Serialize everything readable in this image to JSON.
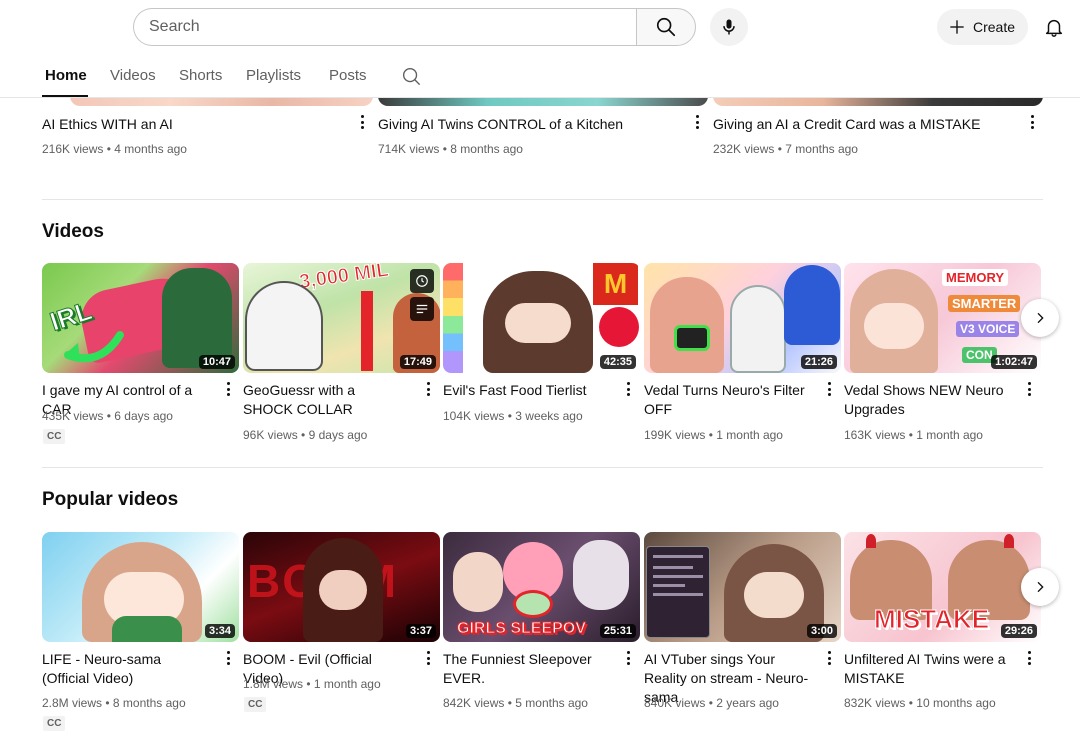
{
  "header": {
    "search_placeholder": "Search",
    "create_label": "Create"
  },
  "tabs": [
    "Home",
    "Videos",
    "Shorts",
    "Playlists",
    "Posts"
  ],
  "top_row": [
    {
      "title": "AI Ethics WITH an AI",
      "views": "216K views",
      "age": "4 months ago"
    },
    {
      "title": "Giving AI Twins CONTROL of a Kitchen",
      "views": "714K views",
      "age": "8 months ago"
    },
    {
      "title": "Giving an AI a Credit Card was a MISTAKE",
      "views": "232K views",
      "age": "7 months ago"
    }
  ],
  "videos_section": {
    "title": "Videos",
    "items": [
      {
        "title": "I gave my AI control of a CAR",
        "views": "435K views",
        "age": "6 days ago",
        "duration": "10:47",
        "cc": "CC"
      },
      {
        "title": "GeoGuessr with a SHOCK COLLAR",
        "views": "96K views",
        "age": "9 days ago",
        "duration": "17:49"
      },
      {
        "title": "Evil's Fast Food Tierlist",
        "views": "104K views",
        "age": "3 weeks ago",
        "duration": "42:35"
      },
      {
        "title": "Vedal Turns Neuro's Filter OFF",
        "views": "199K views",
        "age": "1 month ago",
        "duration": "21:26"
      },
      {
        "title": "Vedal Shows NEW Neuro Upgrades",
        "views": "163K views",
        "age": "1 month ago",
        "duration": "1:02:47"
      }
    ],
    "thumb_text": {
      "irl": "IRL",
      "miles": "3,000 MIL",
      "memory": "MEMORY",
      "smarter": "SMARTER",
      "v3": "V3 VOICE",
      "con": "CON"
    }
  },
  "popular_section": {
    "title": "Popular videos",
    "items": [
      {
        "title": "LIFE - Neuro-sama (Official Video)",
        "views": "2.8M views",
        "age": "8 months ago",
        "duration": "3:34",
        "cc": "CC"
      },
      {
        "title": "BOOM - Evil (Official Video)",
        "views": "1.8M views",
        "age": "1 month ago",
        "duration": "3:37",
        "cc": "CC"
      },
      {
        "title": "The Funniest Sleepover EVER.",
        "views": "842K views",
        "age": "5 months ago",
        "duration": "25:31"
      },
      {
        "title": "AI VTuber sings Your Reality on stream - Neuro-sama",
        "views": "840K views",
        "age": "2 years ago",
        "duration": "3:00"
      },
      {
        "title": "Unfiltered AI Twins were a MISTAKE",
        "views": "832K views",
        "age": "10 months ago",
        "duration": "29:26"
      }
    ],
    "thumb_text": {
      "boom": "BOOM",
      "sleepover": "GIRLS SLEEPOV",
      "mistake": "MISTAKE"
    }
  },
  "separator": "•",
  "colors": {
    "accent_red": "#cc0000",
    "text": "#0f0f0f",
    "meta": "#606060"
  }
}
